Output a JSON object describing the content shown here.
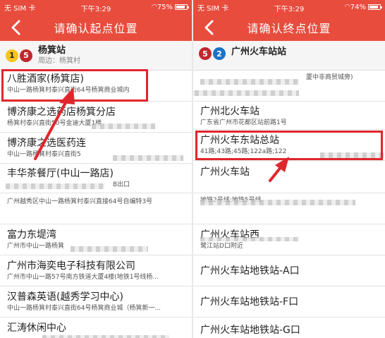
{
  "colors": {
    "accent": "#e84c3d",
    "highlight": "#e0262d",
    "line1": "#f5c518",
    "line5": "#c0282e",
    "line2": "#1a73c8"
  },
  "left": {
    "status": {
      "carrier": "无 SIM 卡",
      "time": "下午3:29",
      "battery": "75%",
      "battery_level": 0.75
    },
    "title": "请确认起点位置",
    "station": {
      "lines": [
        "1",
        "5"
      ],
      "name": "杨箕站",
      "sub": "周边：杨箕村"
    },
    "items": [
      {
        "title": "八胜酒家(杨箕店)",
        "sub": "中山一路杨箕村泰兴直街64号杨箕商业城内"
      },
      {
        "title": "博济康之选药店杨箕分店",
        "sub": "杨箕村泰兴直街50号金迪大厦1楼"
      },
      {
        "title": "博济康之选医药连",
        "sub": "中山一路杨箕村泰兴直街5"
      },
      {
        "title": "丰华茶餐厅(中山一路店)",
        "sub": "B出口"
      },
      {
        "title": "",
        "sub": "广州越秀区中山一路杨箕村泰兴直接64号自编特3号"
      },
      {
        "title": "富力东堤湾",
        "sub": "广州市中山一路杨箕"
      },
      {
        "title": "广州市海奕电子科技有限公司",
        "sub": "广州市中山一路57号南方铁道大厦4楼(地铁1号线杨..."
      },
      {
        "title": "汉普森英语(越秀学习中心)",
        "sub": "中山一路杨箕村泰兴直街64号杨箕商业城（杨箕新一..."
      },
      {
        "title": "汇涛休闲中心",
        "sub": ""
      }
    ]
  },
  "right": {
    "status": {
      "carrier": "无 SIM 卡",
      "time": "下午3:29",
      "battery": "74%",
      "battery_level": 0.74
    },
    "title": "请确认终点位置",
    "station": {
      "lines": [
        "5",
        "2"
      ],
      "name": "广州火车站站"
    },
    "items": [
      {
        "title": "",
        "sub": "厦中非商贸城旁)"
      },
      {
        "title": "广州北火车站",
        "sub": "广东省广州市花都区站前路1号"
      },
      {
        "title": "广州火车东站总站",
        "sub": "41路;43路;45路;122a路;122"
      },
      {
        "title": "广州火车站",
        "sub": ""
      },
      {
        "title": "",
        "sub": "地铁2号线;地铁5号线"
      },
      {
        "title": "广州火车站西",
        "sub": "鹭江站D口附近"
      },
      {
        "title": "广州火车站地铁站-A口",
        "sub": ""
      },
      {
        "title": "广州火车站地铁站-F口",
        "sub": ""
      },
      {
        "title": "广州火车站地铁站-G口",
        "sub": ""
      }
    ]
  }
}
